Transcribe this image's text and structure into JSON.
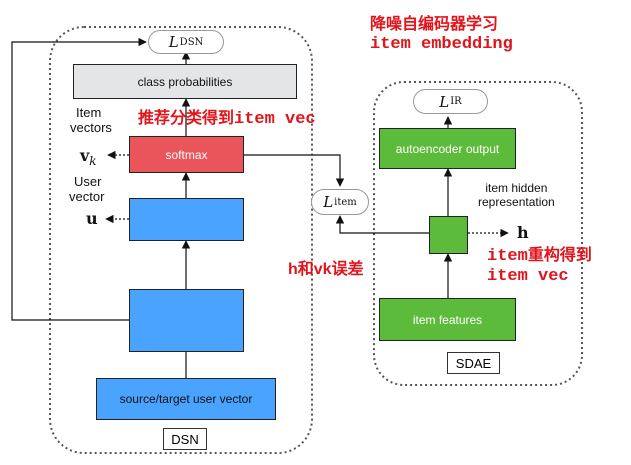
{
  "colors": {
    "red_annotation": "#e2141b",
    "softmax_box": "#e9555a",
    "blue_box": "#4aa3ff",
    "green_box": "#5dbb3b",
    "gray_box": "#e4e5e7"
  },
  "dsn": {
    "container_label": "DSN",
    "loss_symbol": "L",
    "loss_subscript": "DSN",
    "class_prob_label": "class probabilities",
    "softmax_label": "softmax",
    "input_label": "source/target user vector",
    "item_vectors_label_line1": "Item",
    "item_vectors_label_line2": "vectors",
    "item_vector_symbol": "v",
    "item_vector_subscript": "k",
    "user_vector_label_line1": "User",
    "user_vector_label_line2": "vector",
    "user_vector_symbol": "u"
  },
  "sdae": {
    "container_label": "SDAE",
    "loss_symbol": "L",
    "loss_subscript": "IR",
    "autoencoder_output_label": "autoencoder output",
    "item_features_label": "item features",
    "hidden_label_line1": "item hidden",
    "hidden_label_line2": "representation",
    "hidden_symbol": "h"
  },
  "item_loss": {
    "symbol": "L",
    "subscript": "item"
  },
  "annotations": {
    "title_cn": "降噪自编码器学习",
    "title_en": "item embedding",
    "softmax_note_cn": "推荐分类得到",
    "softmax_note_en": "item vec",
    "error_note_prefix": "h和vk",
    "error_note_suffix": "误差",
    "reconstruct_note_line1_en": "item",
    "reconstruct_note_line1_cn": "重构得到",
    "reconstruct_note_line2": "item vec"
  }
}
